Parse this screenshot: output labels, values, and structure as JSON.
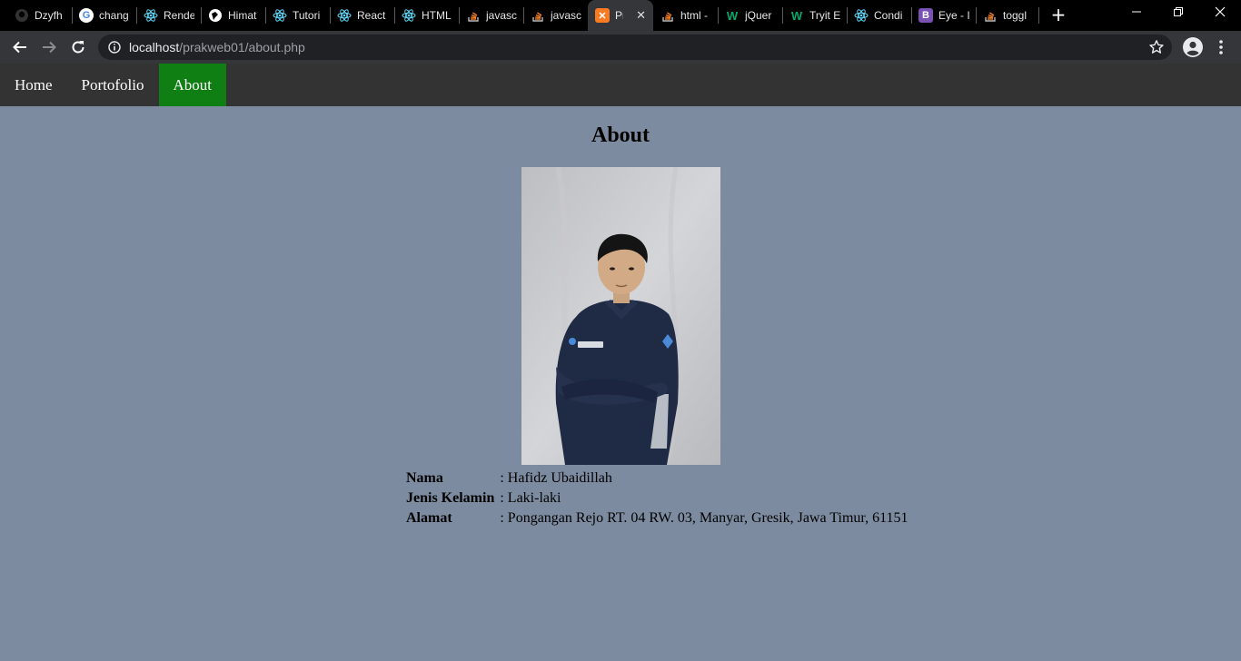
{
  "browser": {
    "tabs": [
      {
        "label": "Dzyfh",
        "icon": "github-icon"
      },
      {
        "label": "chang",
        "icon": "google-icon"
      },
      {
        "label": "Rende",
        "icon": "react-icon"
      },
      {
        "label": "Himat",
        "icon": "globe-icon"
      },
      {
        "label": "Tutori",
        "icon": "react-icon"
      },
      {
        "label": "React",
        "icon": "react-icon"
      },
      {
        "label": "HTML",
        "icon": "react-icon"
      },
      {
        "label": "javasc",
        "icon": "stackoverflow-icon"
      },
      {
        "label": "javasc",
        "icon": "stackoverflow-icon"
      },
      {
        "label": "Pr",
        "icon": "xampp-icon",
        "active": true
      },
      {
        "label": "html -",
        "icon": "stackoverflow-icon"
      },
      {
        "label": "jQuer",
        "icon": "w3schools-icon"
      },
      {
        "label": "Tryit E",
        "icon": "w3schools-icon"
      },
      {
        "label": "Condi",
        "icon": "react-icon"
      },
      {
        "label": "Eye - I",
        "icon": "bootstrap-icon"
      },
      {
        "label": "toggl",
        "icon": "stackoverflow-icon"
      }
    ],
    "address": {
      "host": "localhost",
      "path": "/prakweb01/about.php"
    },
    "colors": {
      "tabstrip": "#000000",
      "toolbar": "#35363a",
      "omnibox": "#202124"
    }
  },
  "nav": {
    "items": [
      {
        "label": "Home"
      },
      {
        "label": "Portofolio"
      },
      {
        "label": "About",
        "active": true
      }
    ],
    "active_color": "#0f7f14"
  },
  "page": {
    "title": "About",
    "background": "#7c8ba0",
    "profile": {
      "rows": [
        {
          "key": "Nama",
          "value": ": Hafidz Ubaidillah"
        },
        {
          "key": "Jenis Kelamin",
          "value": ": Laki-laki"
        },
        {
          "key": "Alamat",
          "value": ": Pongangan Rejo RT. 04 RW. 03, Manyar, Gresik, Jawa Timur, 61151"
        }
      ]
    }
  }
}
